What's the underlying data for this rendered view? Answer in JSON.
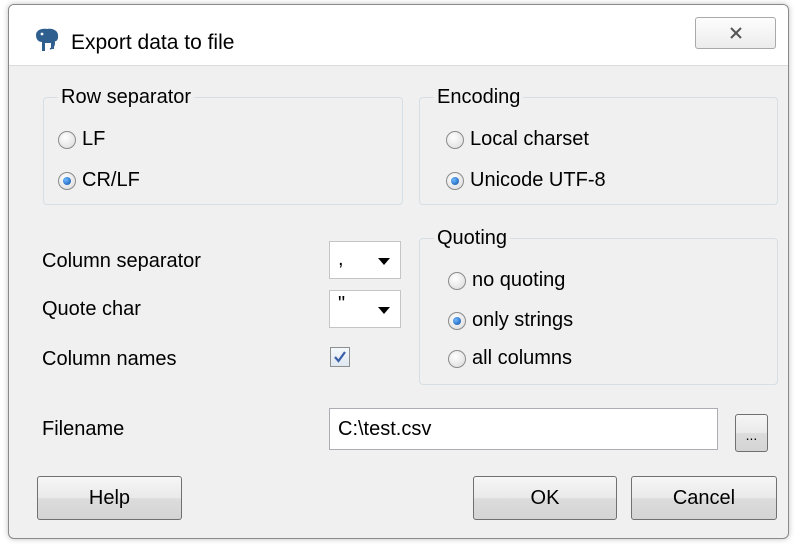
{
  "window": {
    "title": "Export data to file"
  },
  "row_separator": {
    "legend": "Row separator",
    "options": [
      "LF",
      "CR/LF"
    ],
    "selected": "CR/LF"
  },
  "encoding": {
    "legend": "Encoding",
    "options": [
      "Local charset",
      "Unicode UTF-8"
    ],
    "selected": "Unicode UTF-8"
  },
  "quoting": {
    "legend": "Quoting",
    "options": [
      "no quoting",
      "only strings",
      "all columns"
    ],
    "selected": "only strings"
  },
  "fields": {
    "column_separator_label": "Column separator",
    "column_separator_value": ",",
    "quote_char_label": "Quote char",
    "quote_char_value": "\"",
    "column_names_label": "Column names",
    "column_names_checked": true,
    "filename_label": "Filename",
    "filename_value": "C:\\test.csv",
    "browse_label": "..."
  },
  "buttons": {
    "help": "Help",
    "ok": "OK",
    "cancel": "Cancel"
  },
  "icons": {
    "app": "elephant-icon",
    "close": "close-icon",
    "dropdown": "chevron-down-icon",
    "check": "checkmark-icon"
  },
  "colors": {
    "radio_selected": "#0b4fa8",
    "group_border": "#d5dfe5",
    "dialog_bg": "#f0f0f0"
  }
}
